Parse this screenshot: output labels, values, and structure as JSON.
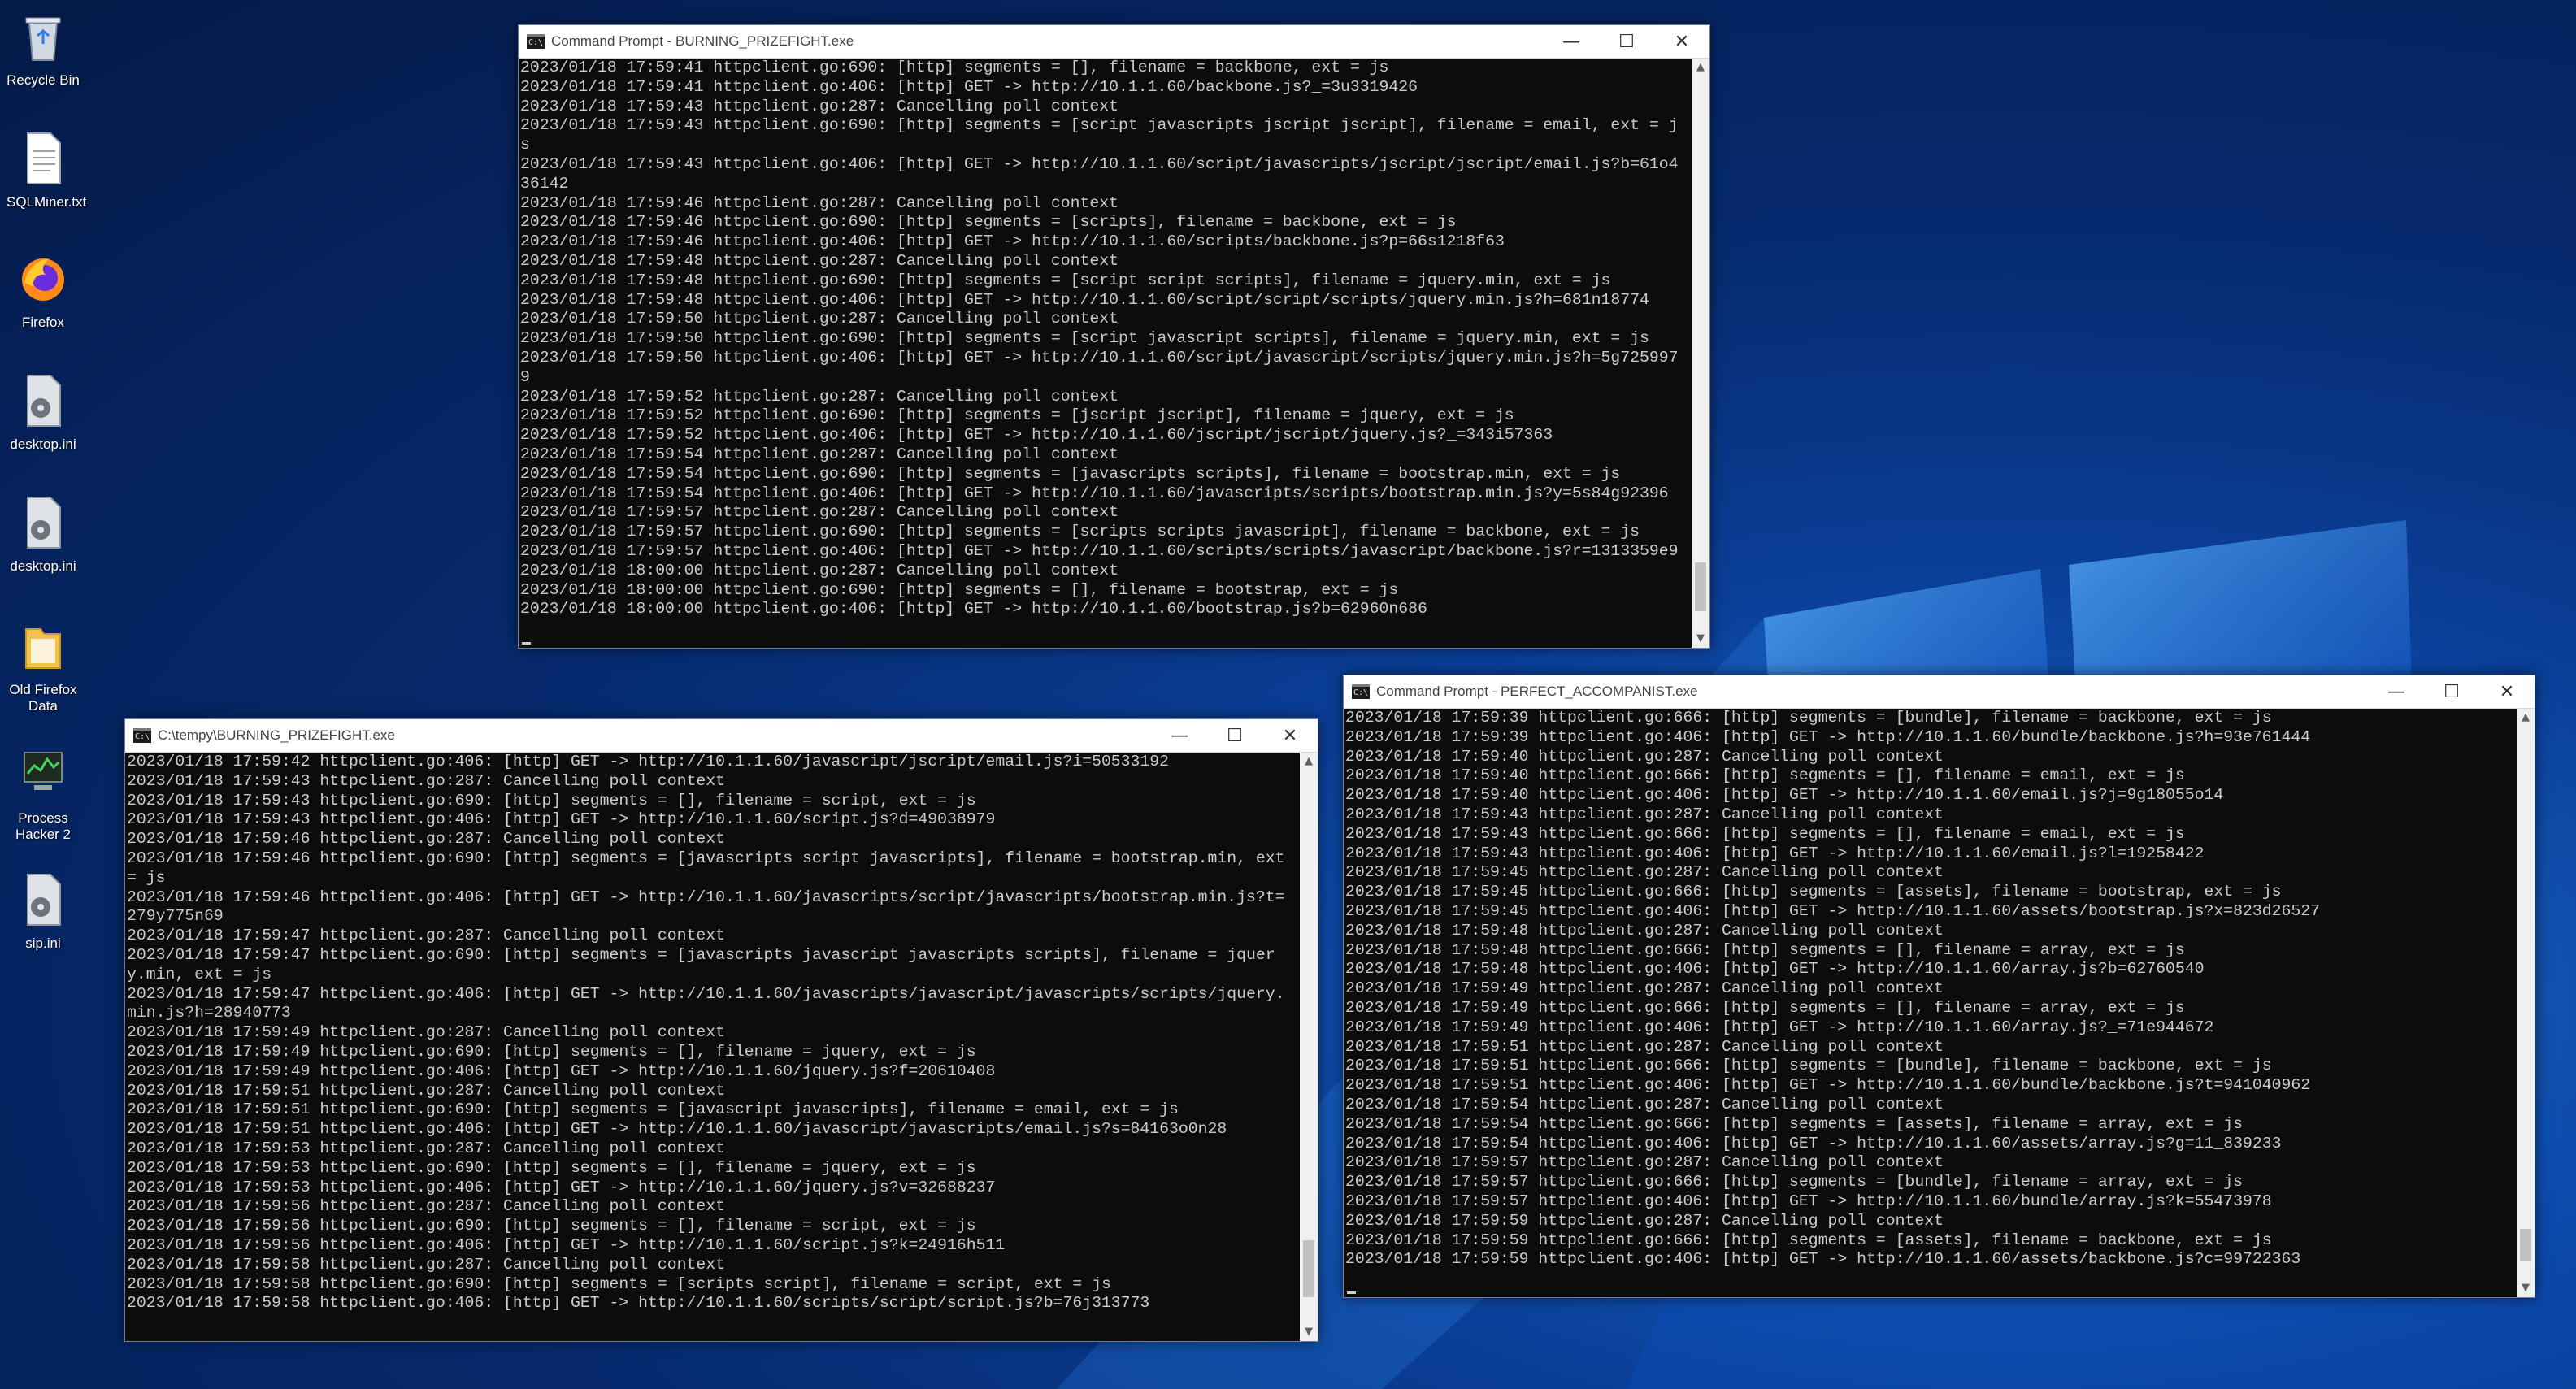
{
  "desktop_icons": [
    {
      "label": "Recycle Bin",
      "icon": "recycle-bin-icon"
    },
    {
      "label": "SQLMiner.txt",
      "icon": "text-file-icon"
    },
    {
      "label": "Firefox",
      "icon": "firefox-icon"
    },
    {
      "label": "desktop.ini",
      "icon": "settings-file-icon"
    },
    {
      "label": "desktop.ini",
      "icon": "settings-file-icon"
    },
    {
      "label": "Old Firefox Data",
      "icon": "folder-icon"
    },
    {
      "label": "Process Hacker 2",
      "icon": "process-hacker-icon"
    },
    {
      "label": "sip.ini",
      "icon": "settings-file-icon"
    }
  ],
  "window_top": {
    "title": "Command Prompt - BURNING_PRIZEFIGHT.exe",
    "lines": [
      "2023/01/18 17:59:41 httpclient.go:690: [http] segments = [], filename = backbone, ext = js",
      "2023/01/18 17:59:41 httpclient.go:406: [http] GET -> http://10.1.1.60/backbone.js?_=3u3319426",
      "2023/01/18 17:59:43 httpclient.go:287: Cancelling poll context",
      "2023/01/18 17:59:43 httpclient.go:690: [http] segments = [script javascripts jscript jscript], filename = email, ext = js",
      "2023/01/18 17:59:43 httpclient.go:406: [http] GET -> http://10.1.1.60/script/javascripts/jscript/jscript/email.js?b=61o436142",
      "2023/01/18 17:59:46 httpclient.go:287: Cancelling poll context",
      "2023/01/18 17:59:46 httpclient.go:690: [http] segments = [scripts], filename = backbone, ext = js",
      "2023/01/18 17:59:46 httpclient.go:406: [http] GET -> http://10.1.1.60/scripts/backbone.js?p=66s1218f63",
      "2023/01/18 17:59:48 httpclient.go:287: Cancelling poll context",
      "2023/01/18 17:59:48 httpclient.go:690: [http] segments = [script script scripts], filename = jquery.min, ext = js",
      "2023/01/18 17:59:48 httpclient.go:406: [http] GET -> http://10.1.1.60/script/script/scripts/jquery.min.js?h=681n18774",
      "2023/01/18 17:59:50 httpclient.go:287: Cancelling poll context",
      "2023/01/18 17:59:50 httpclient.go:690: [http] segments = [script javascript scripts], filename = jquery.min, ext = js",
      "2023/01/18 17:59:50 httpclient.go:406: [http] GET -> http://10.1.1.60/script/javascript/scripts/jquery.min.js?h=5g7259979",
      "2023/01/18 17:59:52 httpclient.go:287: Cancelling poll context",
      "2023/01/18 17:59:52 httpclient.go:690: [http] segments = [jscript jscript], filename = jquery, ext = js",
      "2023/01/18 17:59:52 httpclient.go:406: [http] GET -> http://10.1.1.60/jscript/jscript/jquery.js?_=343i57363",
      "2023/01/18 17:59:54 httpclient.go:287: Cancelling poll context",
      "2023/01/18 17:59:54 httpclient.go:690: [http] segments = [javascripts scripts], filename = bootstrap.min, ext = js",
      "2023/01/18 17:59:54 httpclient.go:406: [http] GET -> http://10.1.1.60/javascripts/scripts/bootstrap.min.js?y=5s84g92396",
      "2023/01/18 17:59:57 httpclient.go:287: Cancelling poll context",
      "2023/01/18 17:59:57 httpclient.go:690: [http] segments = [scripts scripts javascript], filename = backbone, ext = js",
      "2023/01/18 17:59:57 httpclient.go:406: [http] GET -> http://10.1.1.60/scripts/scripts/javascript/backbone.js?r=1313359e9",
      "2023/01/18 18:00:00 httpclient.go:287: Cancelling poll context",
      "2023/01/18 18:00:00 httpclient.go:690: [http] segments = [], filename = bootstrap, ext = js",
      "2023/01/18 18:00:00 httpclient.go:406: [http] GET -> http://10.1.1.60/bootstrap.js?b=62960n686"
    ]
  },
  "window_left": {
    "title": "C:\\tempy\\BURNING_PRIZEFIGHT.exe",
    "lines": [
      "2023/01/18 17:59:42 httpclient.go:406: [http] GET -> http://10.1.1.60/javascript/jscript/email.js?i=50533192",
      "2023/01/18 17:59:43 httpclient.go:287: Cancelling poll context",
      "2023/01/18 17:59:43 httpclient.go:690: [http] segments = [], filename = script, ext = js",
      "2023/01/18 17:59:43 httpclient.go:406: [http] GET -> http://10.1.1.60/script.js?d=49038979",
      "2023/01/18 17:59:46 httpclient.go:287: Cancelling poll context",
      "2023/01/18 17:59:46 httpclient.go:690: [http] segments = [javascripts script javascripts], filename = bootstrap.min, ext = js",
      "2023/01/18 17:59:46 httpclient.go:406: [http] GET -> http://10.1.1.60/javascripts/script/javascripts/bootstrap.min.js?t=279y775n69",
      "2023/01/18 17:59:47 httpclient.go:287: Cancelling poll context",
      "2023/01/18 17:59:47 httpclient.go:690: [http] segments = [javascripts javascript javascripts scripts], filename = jquery.min, ext = js",
      "2023/01/18 17:59:47 httpclient.go:406: [http] GET -> http://10.1.1.60/javascripts/javascript/javascripts/scripts/jquery.min.js?h=28940773",
      "2023/01/18 17:59:49 httpclient.go:287: Cancelling poll context",
      "2023/01/18 17:59:49 httpclient.go:690: [http] segments = [], filename = jquery, ext = js",
      "2023/01/18 17:59:49 httpclient.go:406: [http] GET -> http://10.1.1.60/jquery.js?f=20610408",
      "2023/01/18 17:59:51 httpclient.go:287: Cancelling poll context",
      "2023/01/18 17:59:51 httpclient.go:690: [http] segments = [javascript javascripts], filename = email, ext = js",
      "2023/01/18 17:59:51 httpclient.go:406: [http] GET -> http://10.1.1.60/javascript/javascripts/email.js?s=84163o0n28",
      "2023/01/18 17:59:53 httpclient.go:287: Cancelling poll context",
      "2023/01/18 17:59:53 httpclient.go:690: [http] segments = [], filename = jquery, ext = js",
      "2023/01/18 17:59:53 httpclient.go:406: [http] GET -> http://10.1.1.60/jquery.js?v=32688237",
      "2023/01/18 17:59:56 httpclient.go:287: Cancelling poll context",
      "2023/01/18 17:59:56 httpclient.go:690: [http] segments = [], filename = script, ext = js",
      "2023/01/18 17:59:56 httpclient.go:406: [http] GET -> http://10.1.1.60/script.js?k=24916h511",
      "2023/01/18 17:59:58 httpclient.go:287: Cancelling poll context",
      "2023/01/18 17:59:58 httpclient.go:690: [http] segments = [scripts script], filename = script, ext = js",
      "2023/01/18 17:59:58 httpclient.go:406: [http] GET -> http://10.1.1.60/scripts/script/script.js?b=76j313773"
    ]
  },
  "window_right": {
    "title": "Command Prompt - PERFECT_ACCOMPANIST.exe",
    "lines": [
      "2023/01/18 17:59:39 httpclient.go:666: [http] segments = [bundle], filename = backbone, ext = js",
      "2023/01/18 17:59:39 httpclient.go:406: [http] GET -> http://10.1.1.60/bundle/backbone.js?h=93e761444",
      "2023/01/18 17:59:40 httpclient.go:287: Cancelling poll context",
      "2023/01/18 17:59:40 httpclient.go:666: [http] segments = [], filename = email, ext = js",
      "2023/01/18 17:59:40 httpclient.go:406: [http] GET -> http://10.1.1.60/email.js?j=9g18055o14",
      "2023/01/18 17:59:43 httpclient.go:287: Cancelling poll context",
      "2023/01/18 17:59:43 httpclient.go:666: [http] segments = [], filename = email, ext = js",
      "2023/01/18 17:59:43 httpclient.go:406: [http] GET -> http://10.1.1.60/email.js?l=19258422",
      "2023/01/18 17:59:45 httpclient.go:287: Cancelling poll context",
      "2023/01/18 17:59:45 httpclient.go:666: [http] segments = [assets], filename = bootstrap, ext = js",
      "2023/01/18 17:59:45 httpclient.go:406: [http] GET -> http://10.1.1.60/assets/bootstrap.js?x=823d26527",
      "2023/01/18 17:59:48 httpclient.go:287: Cancelling poll context",
      "2023/01/18 17:59:48 httpclient.go:666: [http] segments = [], filename = array, ext = js",
      "2023/01/18 17:59:48 httpclient.go:406: [http] GET -> http://10.1.1.60/array.js?b=62760540",
      "2023/01/18 17:59:49 httpclient.go:287: Cancelling poll context",
      "2023/01/18 17:59:49 httpclient.go:666: [http] segments = [], filename = array, ext = js",
      "2023/01/18 17:59:49 httpclient.go:406: [http] GET -> http://10.1.1.60/array.js?_=71e944672",
      "2023/01/18 17:59:51 httpclient.go:287: Cancelling poll context",
      "2023/01/18 17:59:51 httpclient.go:666: [http] segments = [bundle], filename = backbone, ext = js",
      "2023/01/18 17:59:51 httpclient.go:406: [http] GET -> http://10.1.1.60/bundle/backbone.js?t=941040962",
      "2023/01/18 17:59:54 httpclient.go:287: Cancelling poll context",
      "2023/01/18 17:59:54 httpclient.go:666: [http] segments = [assets], filename = array, ext = js",
      "2023/01/18 17:59:54 httpclient.go:406: [http] GET -> http://10.1.1.60/assets/array.js?g=11_839233",
      "2023/01/18 17:59:57 httpclient.go:287: Cancelling poll context",
      "2023/01/18 17:59:57 httpclient.go:666: [http] segments = [bundle], filename = array, ext = js",
      "2023/01/18 17:59:57 httpclient.go:406: [http] GET -> http://10.1.1.60/bundle/array.js?k=55473978",
      "2023/01/18 17:59:59 httpclient.go:287: Cancelling poll context",
      "2023/01/18 17:59:59 httpclient.go:666: [http] segments = [assets], filename = backbone, ext = js",
      "2023/01/18 17:59:59 httpclient.go:406: [http] GET -> http://10.1.1.60/assets/backbone.js?c=99722363"
    ]
  },
  "window_controls": {
    "minimize": "—",
    "maximize": "☐",
    "close": "✕"
  },
  "colors": {
    "console_bg": "#0c0c0c",
    "console_text": "#cccccc",
    "desktop_blue": "#0a3f98"
  }
}
